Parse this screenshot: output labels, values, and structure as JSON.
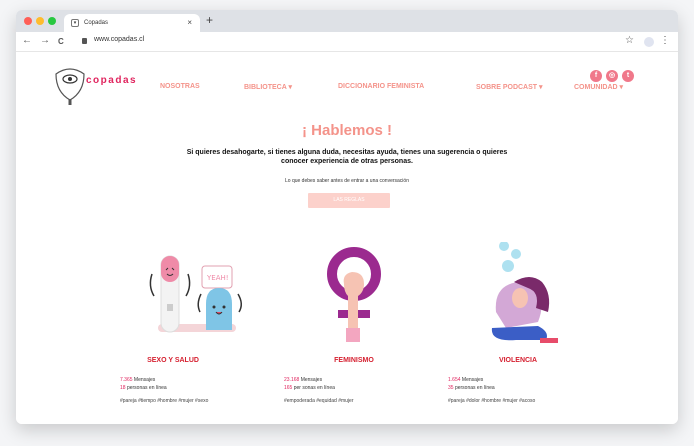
{
  "browser": {
    "tab_title": "Copadas",
    "tab_close": "×",
    "new_tab": "+",
    "url": "www.copadas.cl",
    "nav_back": "←",
    "nav_forward": "→",
    "nav_reload": "C",
    "bookmark": "☆",
    "menu": "⋮",
    "traffic_colors": [
      "#ff5f57",
      "#febc2e",
      "#28c840"
    ]
  },
  "header": {
    "brand": "copadas",
    "nav": [
      "NOSOTRAS",
      "BIBLIOTECA ▾",
      "DICCIONARIO FEMINISTA",
      "SOBRE PODCAST ▾",
      "COMUNIDAD ▾"
    ],
    "social": [
      {
        "name": "facebook-icon",
        "glyph": "f"
      },
      {
        "name": "instagram-icon",
        "glyph": "◎"
      },
      {
        "name": "twitter-icon",
        "glyph": "t"
      }
    ]
  },
  "hero": {
    "title": "¡ Hablemos !",
    "text": "Si quieres desahogarte, si tienes alguna duda, necesitas ayuda, tienes una sugerencia o quieres conocer experiencia de otras personas.",
    "small": "Lo que debes saber antes de entrar a una conversación",
    "button": "LAS REGLAS"
  },
  "cards": [
    {
      "title": "SEXO Y SALUD",
      "messages_num": "7.365",
      "messages_label": "Mensajes",
      "online_num": "18",
      "online_label": "personas en línea",
      "tags": "#pareja  #tiempo  #hombre  #mujer  #sexo",
      "yeah": "YEAH!"
    },
    {
      "title": "FEMINISMO",
      "messages_num": "23.168",
      "messages_label": "Mensajes",
      "online_num": "165",
      "online_label": "per sonas en línea",
      "tags": "#empoderada  #equidad  #mujer"
    },
    {
      "title": "VIOLENCIA",
      "messages_num": "1.654",
      "messages_label": "Mensajes",
      "online_num": "35",
      "online_label": "personas en línea",
      "tags": "#pareja  #dolor  #hombre  #mujer  #acoso"
    }
  ],
  "colors": {
    "accent": "#f4938a",
    "brand": "#e0245e",
    "card_title": "#d51f2f",
    "purple": "#9b2a8f"
  }
}
